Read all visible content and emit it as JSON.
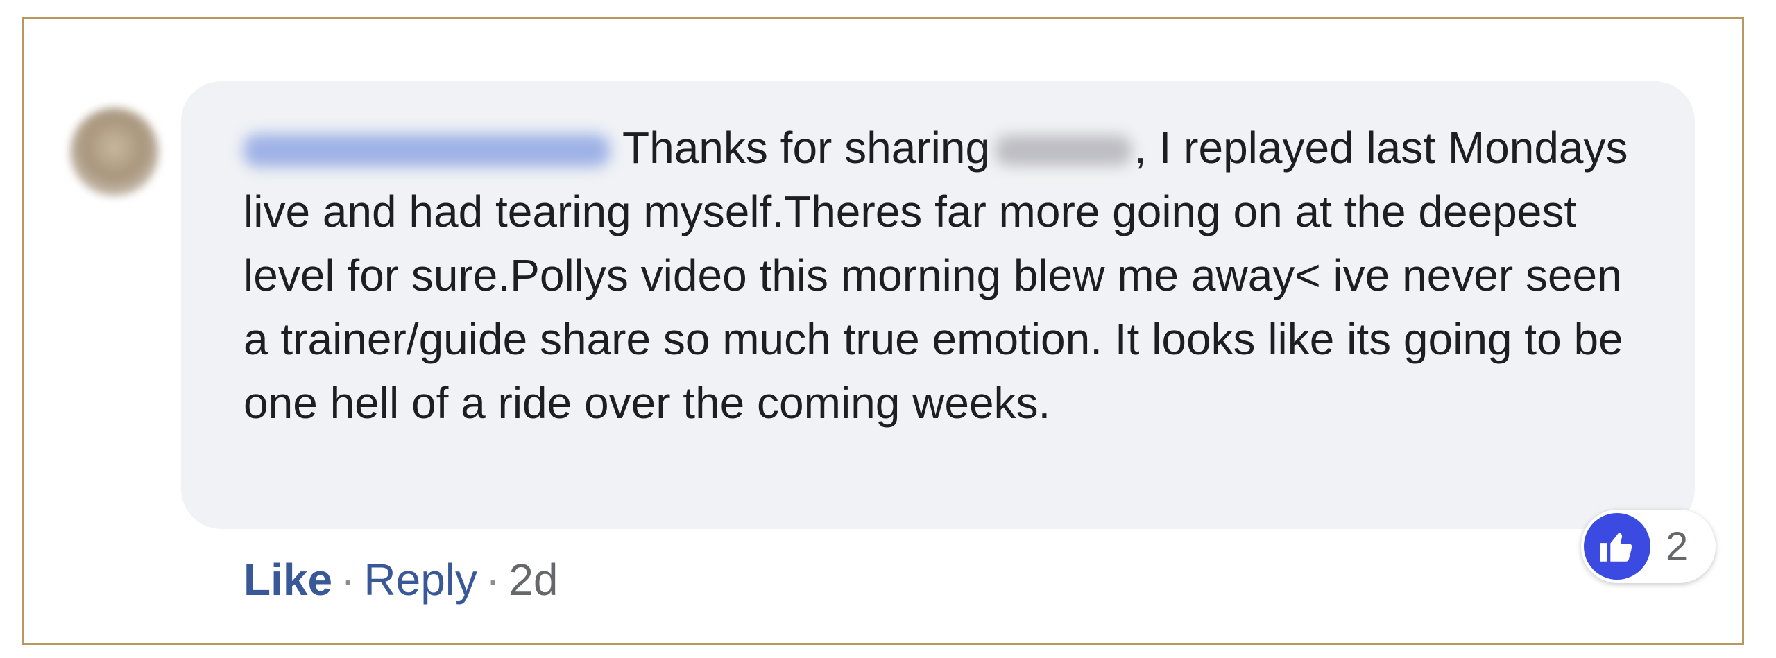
{
  "comment": {
    "text": "Thanks for sharing",
    "text_continued": ", I replayed last Mondays live and had tearing myself.Theres far more going on at the deepest level for sure.Pollys video this morning blew me away< ive never seen a trainer/guide share so much true emotion. It looks like its going to be one hell of a ride over the coming weeks."
  },
  "actions": {
    "like_label": "Like",
    "separator": "·",
    "reply_label": "Reply",
    "timestamp": "2d"
  },
  "reactions": {
    "icon": "thumbs-up-icon",
    "count": "2",
    "color": "#3b4ae0"
  },
  "colors": {
    "frame_border": "#b8985e",
    "bubble_bg": "#f0f2f5",
    "link": "#385898",
    "text": "#1c1e21",
    "meta": "#65676b"
  }
}
